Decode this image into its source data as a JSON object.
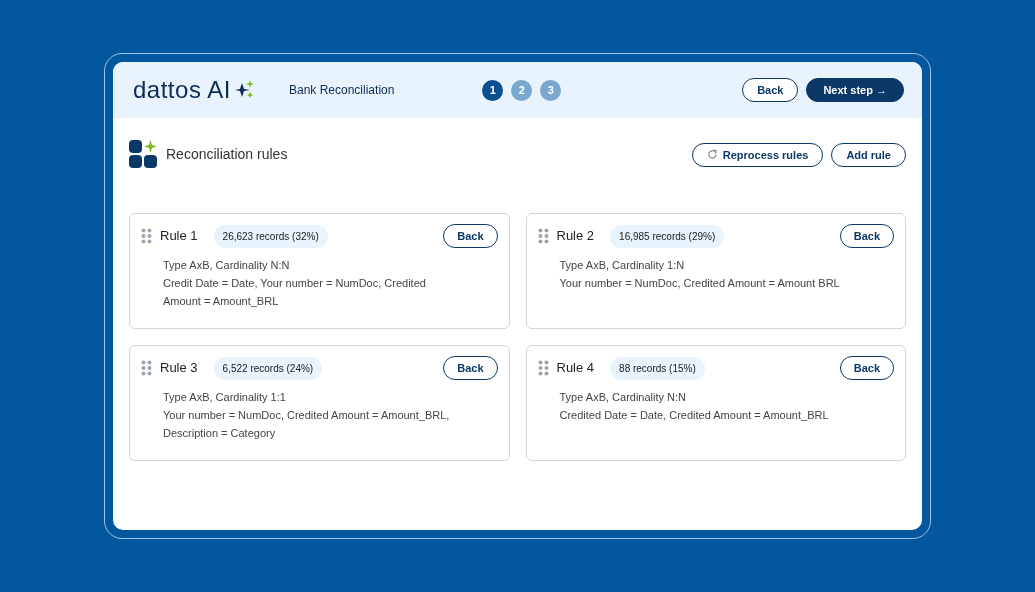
{
  "header": {
    "logo": "dattos AI",
    "title": "Bank Reconciliation",
    "steps": [
      {
        "label": "1",
        "selected": true
      },
      {
        "label": "2",
        "selected": false
      },
      {
        "label": "3",
        "selected": false
      }
    ],
    "buttons": [
      {
        "label": "Back",
        "kind": "outline"
      },
      {
        "label": "Next step →",
        "kind": "primary"
      }
    ]
  },
  "section": {
    "title": "Reconciliation rules",
    "buttons": [
      {
        "label": "Reprocess rules",
        "kind": "reprocess"
      },
      {
        "label": "Add rule",
        "kind": "outline"
      }
    ]
  },
  "rules": [
    {
      "name": "Rule 1",
      "records": "26,623 records (32%)",
      "button": "Back",
      "type": "Type AxB, Cardinality N:N",
      "mapping": "Credit Date = Date, Your number = NumDoc, Credited Amount = Amount_BRL"
    },
    {
      "name": "Rule 2",
      "records": "16,985 records (29%)",
      "button": "Back",
      "type": "Type AxB, Cardinality 1:N",
      "mapping": "Your number = NumDoc, Credited Amount = Amount BRL"
    },
    {
      "name": "Rule 3",
      "records": "6,522 records (24%)",
      "button": "Back",
      "type": "Type AxB, Cardinality 1:1",
      "mapping": "Your number = NumDoc, Credited Amount = Amount_BRL, Description = Category"
    },
    {
      "name": "Rule 4",
      "records": "88 records (15%)",
      "button": "Back",
      "type": "Type AxB, Cardinality N:N",
      "mapping": "Credited Date = Date, Credited Amount = Amount_BRL"
    }
  ]
}
